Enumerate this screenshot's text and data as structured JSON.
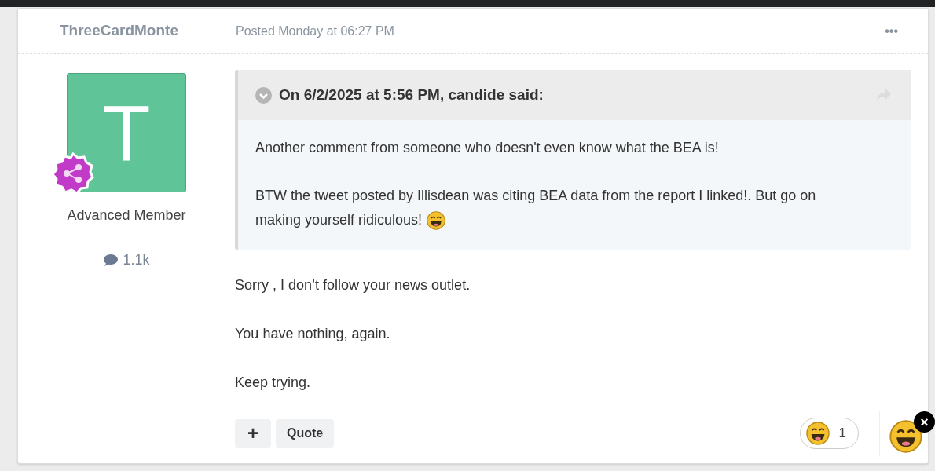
{
  "post": {
    "author": "ThreeCardMonte",
    "posted": "Posted Monday at 06:27 PM",
    "menu": "•••",
    "avatar_letter": "T",
    "rank": "Advanced Member",
    "post_count": "1.1k",
    "quote": {
      "header": "On 6/2/2025 at 5:56 PM, candide said:",
      "paragraphs": [
        {
          "lines": [
            "Another comment from someone who doesn't even know what the BEA is!"
          ],
          "emoji": false
        },
        {
          "lines": [
            "BTW the tweet posted by Illisdean was citing BEA data from the report I linked!. But go on",
            "making yourself ridiculous!"
          ],
          "emoji": true
        }
      ]
    },
    "body": [
      "Sorry , I don’t follow your news outlet.",
      "You have nothing, again.",
      "Keep trying."
    ],
    "buttons": [
      {
        "kind": "icon",
        "label": "+"
      },
      {
        "kind": "text",
        "label": "Quote"
      }
    ],
    "reaction_count": "1",
    "close": "×"
  }
}
